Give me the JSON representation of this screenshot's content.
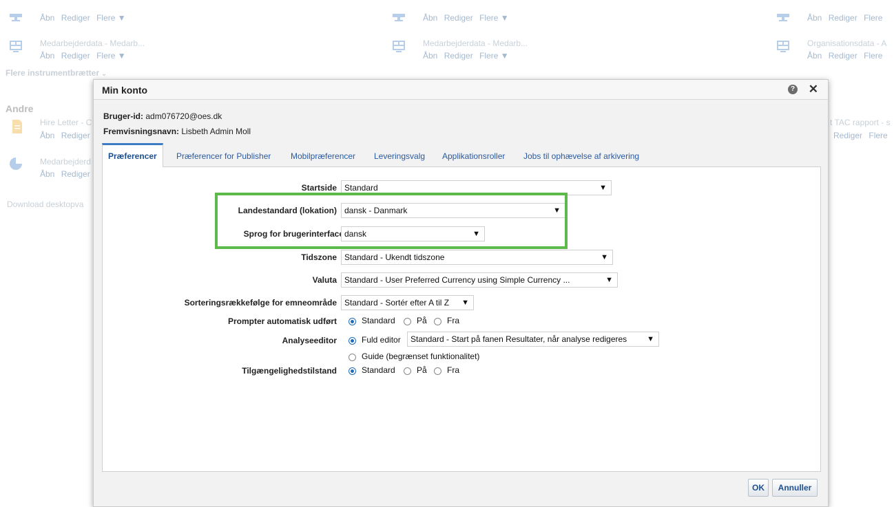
{
  "background": {
    "actions": {
      "open": "Åbn",
      "edit": "Rediger",
      "more": "Flere ▼",
      "more_short": "Flere"
    },
    "items": [
      {
        "title": "Medarbejderdata - Medarb..."
      },
      {
        "title": "Medarbejderdata - Medarb..."
      },
      {
        "title": "Organisationsdata - A"
      }
    ],
    "more_dashboards": "Flere instrumentbrætter",
    "other_heading": "Andre",
    "other_items": [
      {
        "title": "Hire Letter - C"
      },
      {
        "title": "Medarbejderd"
      }
    ],
    "right_fragment_title": "t TAC rapport - s",
    "right_fragment_actions": "Rediger",
    "download_link": "Download desktopva"
  },
  "dialog": {
    "title": "Min konto",
    "user_id_label": "Bruger-id:",
    "user_id_value": "adm076720@oes.dk",
    "display_name_label": "Fremvisningsnavn:",
    "display_name_value": "Lisbeth Admin Moll",
    "tabs": [
      {
        "label": "Præferencer",
        "active": true
      },
      {
        "label": "Præferencer for Publisher"
      },
      {
        "label": "Mobilpræferencer"
      },
      {
        "label": "Leveringsvalg"
      },
      {
        "label": "Applikationsroller"
      },
      {
        "label": "Jobs til ophævelse af arkivering"
      }
    ],
    "fields": {
      "startside": {
        "label": "Startside",
        "value": "Standard"
      },
      "locale": {
        "label": "Landestandard (lokation)",
        "value": "dansk - Danmark"
      },
      "ui_language": {
        "label": "Sprog for brugerinterface",
        "value": "dansk"
      },
      "timezone": {
        "label": "Tidszone",
        "value": "Standard - Ukendt tidszone"
      },
      "currency": {
        "label": "Valuta",
        "value": "Standard - User Preferred Currency using Simple Currency ..."
      },
      "sort_order": {
        "label": "Sorteringsrækkefølge for emneområde",
        "value": "Standard - Sortér efter A til Z"
      },
      "auto_prompt": {
        "label": "Prompter automatisk udført",
        "options": [
          "Standard",
          "På",
          "Fra"
        ],
        "selected": "Standard"
      },
      "analysis_editor": {
        "label": "Analyseeditor",
        "option_full": "Fuld editor",
        "full_select_value": "Standard - Start på fanen Resultater, når analyse redigeres",
        "option_guide": "Guide (begrænset funktionalitet)",
        "selected": "Fuld editor"
      },
      "accessibility": {
        "label": "Tilgængelighedstilstand",
        "options": [
          "Standard",
          "På",
          "Fra"
        ],
        "selected": "Standard"
      }
    },
    "buttons": {
      "ok": "OK",
      "cancel": "Annuller"
    }
  },
  "colors": {
    "highlight": "#5cb94a",
    "tab_accent": "#3b7cc4",
    "radio_on": "#1c6bbd"
  }
}
